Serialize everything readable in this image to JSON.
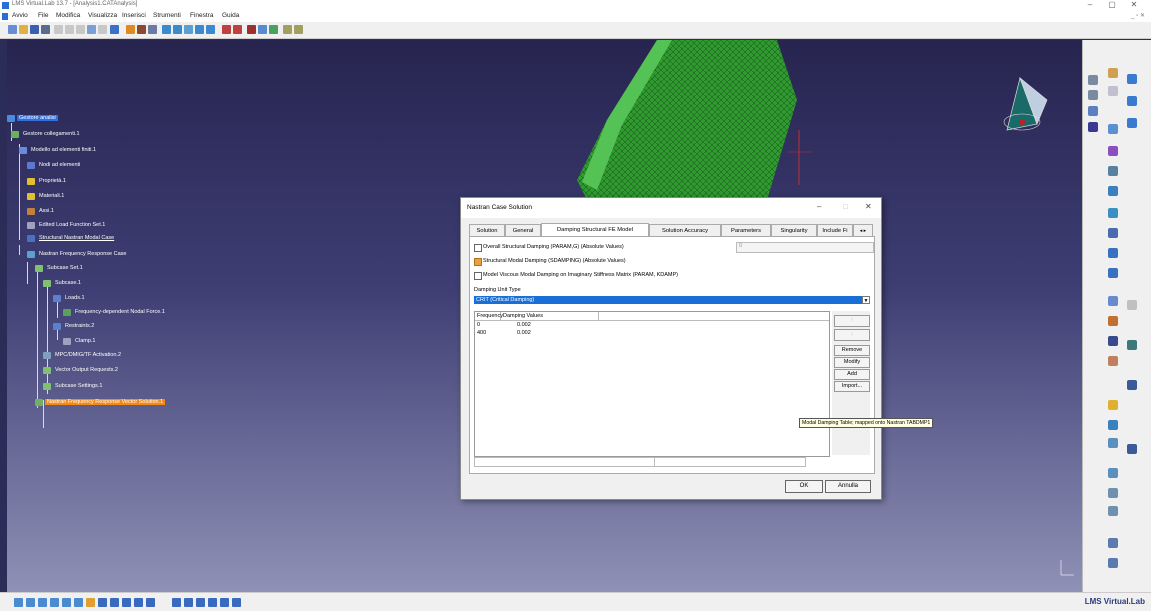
{
  "window": {
    "title": "LMS Virtual.Lab 13.7 - [Analysis1.CATAnalysis]",
    "controls": [
      "–",
      "▢",
      "✕"
    ]
  },
  "menu": [
    "Avvio",
    "File",
    "Modifica",
    "Visualizza",
    "Inserisci",
    "Strumenti",
    "Finestra",
    "Guida"
  ],
  "menu_controls": "_ ▫ ✕",
  "tree": [
    {
      "label": "Gestore analisi",
      "style": "sel"
    },
    {
      "label": "Gestore collegamenti.1",
      "style": ""
    },
    {
      "label": "Modello ad elementi finiti.1",
      "style": ""
    },
    {
      "label": "Nodi ad elementi",
      "style": ""
    },
    {
      "label": "Proprietà.1",
      "style": ""
    },
    {
      "label": "Materiali.1",
      "style": ""
    },
    {
      "label": "Assi.1",
      "style": ""
    },
    {
      "label": "Edited Load Function Set.1",
      "style": ""
    },
    {
      "label": "Structural Nastran Modal Case",
      "style": "ul"
    },
    {
      "label": "Nastran Frequency Response Case",
      "style": ""
    },
    {
      "label": "Subcase Set.1",
      "style": ""
    },
    {
      "label": "Subcase.1",
      "style": ""
    },
    {
      "label": "Loads.1",
      "style": ""
    },
    {
      "label": "Frequency-dependent Nodal Force.1",
      "style": ""
    },
    {
      "label": "Restraints.2",
      "style": ""
    },
    {
      "label": "Clamp.1",
      "style": ""
    },
    {
      "label": "MPC/DMIG/TF Activation.2",
      "style": ""
    },
    {
      "label": "Vector Output Requests.2",
      "style": ""
    },
    {
      "label": "Subcase Settings.1",
      "style": ""
    },
    {
      "label": "Nastran Frequency Response Vector Solution.1",
      "style": "hl"
    }
  ],
  "dialog": {
    "title": "Nastran Case Solution",
    "title_buttons": [
      "–",
      "□",
      "✕"
    ],
    "tabs": [
      "Solution",
      "General",
      "Damping Structural FE Model",
      "Solution Accuracy",
      "Parameters",
      "Singularity",
      "Include Fi"
    ],
    "active_tab": "Damping Structural FE Model",
    "tab_scroll": "◂ ▸",
    "options": [
      {
        "label": "Overall Structural Damping (PARAM,G) (Absolute Values)",
        "checked": false
      },
      {
        "label": "Structural Modal Damping (SDAMPING) (Absolute Values)",
        "checked": true
      },
      {
        "label": "Model Viscous Modal Damping on Imaginary Stiffness Matrix (PARAM, KDAMP)",
        "checked": false
      }
    ],
    "overall_value": "0",
    "group_label": "Damping Unit Type",
    "damping_unit": "CRIT (Critical Damping)",
    "columns": [
      "Frequency",
      "Damping Values"
    ],
    "rows": [
      [
        "0",
        "0.002"
      ],
      [
        "400",
        "0.002"
      ]
    ],
    "side_buttons": [
      {
        "label": "↑",
        "enabled": false
      },
      {
        "label": "↓",
        "enabled": false
      },
      {
        "label": "Remove",
        "enabled": true
      },
      {
        "label": "Modify",
        "enabled": true
      },
      {
        "label": "Add",
        "enabled": true
      },
      {
        "label": "Import...",
        "enabled": true
      }
    ],
    "tooltip": "Modal Damping Table; mapped onto Nastran TABDMP1",
    "ok": "OK",
    "cancel": "Annulla"
  },
  "brand": "LMS Virtual.Lab",
  "colors": {
    "selection": "#2f6fe0",
    "highlight": "#f28a1a",
    "mesh": "#2f9a2f",
    "combo": "#1a6fd6"
  }
}
